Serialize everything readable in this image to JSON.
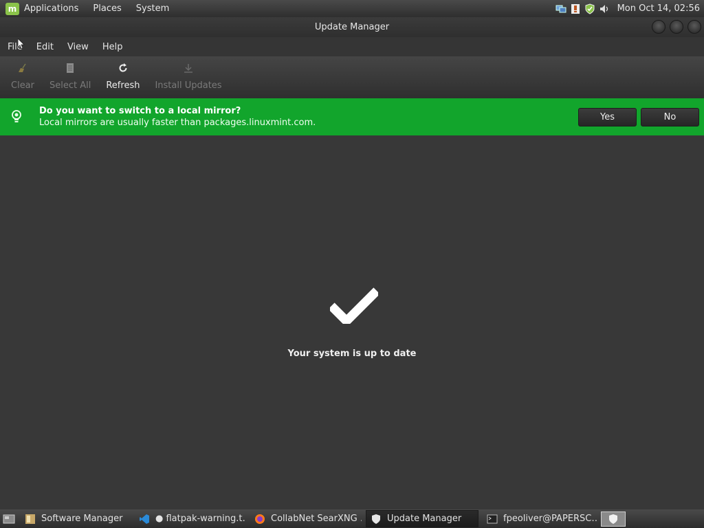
{
  "panel": {
    "menus": [
      "Applications",
      "Places",
      "System"
    ],
    "clock": "Mon Oct 14, 02:56"
  },
  "window": {
    "title": "Update Manager"
  },
  "menubar": [
    "File",
    "Edit",
    "View",
    "Help"
  ],
  "toolbar": {
    "clear": "Clear",
    "select_all": "Select All",
    "refresh": "Refresh",
    "install_updates": "Install Updates"
  },
  "infobar": {
    "title": "Do you want to switch to a local mirror?",
    "subtitle": "Local mirrors are usually faster than packages.linuxmint.com.",
    "yes": "Yes",
    "no": "No",
    "color": "#12a52c"
  },
  "main": {
    "status": "Your system is up to date"
  },
  "taskbar": {
    "tasks": [
      {
        "label": "Software Manager",
        "icon": "software-manager-icon"
      },
      {
        "label": "● flatpak-warning.t…",
        "icon": "vscode-icon"
      },
      {
        "label": "CollabNet SearXNG …",
        "icon": "firefox-icon"
      },
      {
        "label": "Update Manager",
        "icon": "shield-icon"
      },
      {
        "label": "fpeoliver@PAPERSC…",
        "icon": "terminal-icon"
      }
    ]
  }
}
